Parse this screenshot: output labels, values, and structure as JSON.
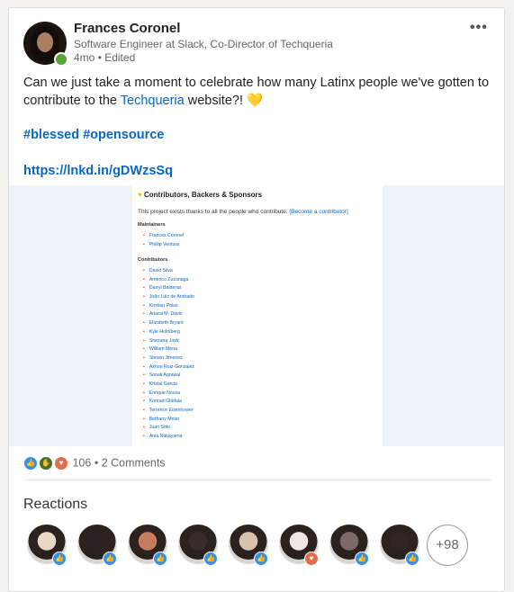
{
  "author": {
    "name": "Frances Coronel",
    "headline": "Software Engineer at Slack, Co-Director of Techqueria",
    "meta": "4mo • Edited"
  },
  "post": {
    "text_before": "Can we just take a moment to celebrate how many Latinx people we've gotten to contribute to the ",
    "link_text": "Techqueria",
    "text_after": " website?! ",
    "emoji": "💛",
    "hashtags": "#blessed #opensource",
    "short_url": "https://lnkd.in/gDWzsSq"
  },
  "document": {
    "title": "Contributors, Backers & Sponsors",
    "subtitle": "This project exists thanks to all the people who contribute.",
    "subtitle_link": "[Become a contributor]",
    "maintainers_heading": "Maintainers",
    "maintainers": [
      "Frances Coronel",
      "Phillip Ventura"
    ],
    "contributors_heading": "Contributors",
    "contributors": [
      "David Silva",
      "Americo Zuzunaga",
      "Darryl Balderas",
      "João Luiz de Andrade",
      "Kristian Polso",
      "Ariana M. Davis",
      "Elizabeth Bryant",
      "Kyle Holmberg",
      "Snezana Jovic",
      "William Mena",
      "Steven Jimenez",
      "Axhon Ruiz-Gonzalez",
      "Sonali Agrawal",
      "Kristal Garcia",
      "Enrique Novoa",
      "Konrad Gladala",
      "Terrence Eisenhower",
      "Bethany Meier",
      "Juan Soto",
      "Ania Nakayama"
    ]
  },
  "social": {
    "reaction_count": "106",
    "separator": "•",
    "comments": "2 Comments",
    "reaction_icons": [
      "like-icon",
      "celebrate-icon",
      "love-icon"
    ]
  },
  "reactions": {
    "title": "Reactions",
    "more_count": "+98",
    "people": [
      {
        "reaction": "like",
        "color": "#e9d7c8"
      },
      {
        "reaction": "like",
        "color": "#2a2322"
      },
      {
        "reaction": "like",
        "color": "#c77b5e"
      },
      {
        "reaction": "like",
        "color": "#3b2b2a"
      },
      {
        "reaction": "like",
        "color": "#d8c2ad"
      },
      {
        "reaction": "love",
        "color": "#efe7e3"
      },
      {
        "reaction": "like",
        "color": "#7c6a66"
      },
      {
        "reaction": "like",
        "color": "#2f2522"
      }
    ]
  },
  "colors": {
    "accent": "#0a66c2",
    "like": "#378fe9",
    "celebrate": "#44712e",
    "love": "#df704d",
    "online": "#57a337"
  }
}
